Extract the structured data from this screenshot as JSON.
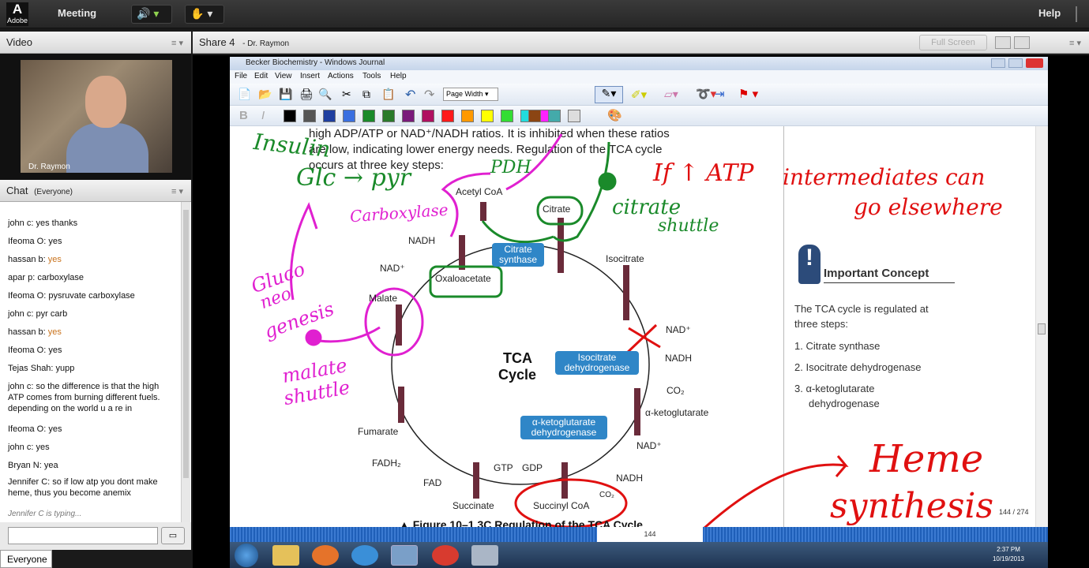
{
  "topbar": {
    "logo_letter": "A",
    "logo_text": "Adobe",
    "meeting_label": "Meeting",
    "help_label": "Help"
  },
  "video_pod": {
    "title": "Video",
    "presenter_name": "Dr. Raymon"
  },
  "share_pod": {
    "title": "Share 4",
    "presenter": "- Dr. Raymon",
    "fullscreen_label": "Full Screen"
  },
  "chat_pod": {
    "title": "Chat",
    "audience": "(Everyone)",
    "messages": [
      {
        "name": "john c:",
        "text": "yes thanks"
      },
      {
        "name": "Ifeoma O:",
        "text": "yes"
      },
      {
        "name": "hassan b:",
        "text": "yes"
      },
      {
        "name": "apar p:",
        "text": "carboxylase"
      },
      {
        "name": "Ifeoma O:",
        "text": "pysruvate carboxylase"
      },
      {
        "name": "john c:",
        "text": "pyr carb"
      },
      {
        "name": "hassan b:",
        "text": "yes"
      },
      {
        "name": "Ifeoma O:",
        "text": "yes"
      },
      {
        "name": "Tejas Shah:",
        "text": "yupp"
      },
      {
        "name": "john c:",
        "text": "so the difference is that the high ATP comes from burning different fuels. depending on the world u a re in"
      },
      {
        "name": "Ifeoma O:",
        "text": "yes"
      },
      {
        "name": "john c:",
        "text": "yes"
      },
      {
        "name": "Bryan N:",
        "text": "yea"
      },
      {
        "name": "Jennifer C:",
        "text": "so if low atp you dont make heme, thus you become anemix"
      }
    ],
    "typing_status": "Jennifer C is typing...",
    "everyone_tab": "Everyone"
  },
  "journal": {
    "window_title": "Becker Biochemistry - Windows Journal",
    "menus": [
      "File",
      "Edit",
      "View",
      "Insert",
      "Actions",
      "Tools",
      "Help"
    ],
    "page_width_label": "Page Width",
    "page_counter": "144 / 274",
    "page_number": "144",
    "swatch_colors": [
      "#000000",
      "#555555",
      "#1f3fa0",
      "#3a6fe0",
      "#1a8a2a",
      "#2a7a2a",
      "#7a1a7a",
      "#b01060",
      "#ff1a1a",
      "#ff9900",
      "#ffff00",
      "#33dd33",
      "#22dddd",
      "#ff22ff",
      "#8b4513",
      "#44aaaa",
      "#dddddd",
      "#ffffff"
    ]
  },
  "book": {
    "paragraph_lines": [
      "high ADP/ATP or NAD⁺/NADH ratios. It is inhibited when these ratios",
      "are low, indicating lower energy needs. Regulation of the TCA cycle",
      "occurs at three key steps:"
    ],
    "cycle_title_1": "TCA",
    "cycle_title_2": "Cycle",
    "metabolites": {
      "acetyl_coa": "Acetyl CoA",
      "citrate": "Citrate",
      "isocitrate": "Isocitrate",
      "oxaloacetate": "Oxaloacetate",
      "malate": "Malate",
      "fumarate": "Fumarate",
      "succinate": "Succinate",
      "succinyl_coa": "Succinyl CoA",
      "ketoglutarate": "α-ketoglutarate"
    },
    "cofactors": {
      "nadh_top": "NADH",
      "nad_top": "NAD⁺",
      "nad_right": "NAD⁺",
      "nadh_right": "NADH",
      "co2_1": "CO₂",
      "nad_lower": "NAD⁺",
      "nadh_lower": "NADH",
      "co2_2": "CO₂",
      "gtp": "GTP",
      "gdp": "GDP",
      "fadh2": "FADH₂",
      "fad": "FAD"
    },
    "enzymes": {
      "citrate_synthase": "Citrate synthase",
      "isocitrate_dh": "Isocitrate dehydrogenase",
      "ketoglutarate_dh": "α-ketoglutarate dehydrogenase"
    },
    "figure_caption": "▲ Figure 10–1 3C  Regulation of the TCA Cycle",
    "concept": {
      "title": "Important Concept",
      "intro": "The TCA cycle is regulated at three steps:",
      "items": [
        "1.  Citrate synthase",
        "2.  Isocitrate dehydrogenase",
        "3.  α-ketoglutarate",
        "     dehydrogenase"
      ]
    }
  },
  "annotations": {
    "insulin": "Insulin",
    "glc_pyr": "Glc → pyr",
    "pdh": "PDH",
    "carboxylase": "Carboxylase",
    "gluconeogenesis_1": "Gluco",
    "gluconeogenesis_2": "neo",
    "gluconeogenesis_3": "genesis",
    "malate_shuttle_1": "malate",
    "malate_shuttle_2": "shuttle",
    "citrate_shuttle_1": "citrate",
    "citrate_shuttle_2": "shuttle",
    "if_atp": "If ↑ ATP",
    "intermediates": "intermediates can",
    "go_elsewhere": "go elsewhere",
    "heme": "Heme",
    "synthesis": "synthesis"
  },
  "taskbar": {
    "time": "2:37 PM",
    "date": "10/19/2013"
  },
  "colors": {
    "annotation_green": "#1a8a2a",
    "annotation_magenta": "#e020d0",
    "annotation_red": "#e01010",
    "enzyme_blue": "#2f86c7",
    "hbar_blue": "#1f5fb8"
  }
}
